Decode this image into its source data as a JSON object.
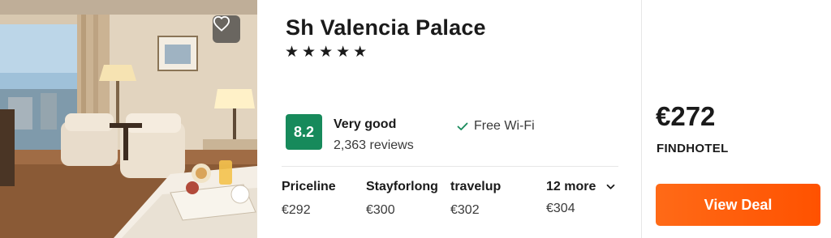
{
  "hotel": {
    "name": "Sh Valencia Palace",
    "stars": "★★★★★",
    "star_count": 5,
    "score": "8.2",
    "rating_word": "Very good",
    "review_count": "2,363 reviews"
  },
  "amenities": [
    "Free Wi-Fi"
  ],
  "providers": [
    {
      "name": "Priceline",
      "price": "€292"
    },
    {
      "name": "Stayforlong",
      "price": "€300"
    },
    {
      "name": "travelup",
      "price": "€302"
    }
  ],
  "more": {
    "label": "12 more",
    "price": "€304"
  },
  "best_deal": {
    "price": "€272",
    "provider": "FINDHOTEL",
    "button_label": "View Deal"
  },
  "icons": {
    "favorite": "heart-icon",
    "amenity_check": "check-icon",
    "expand": "chevron-down-icon"
  },
  "colors": {
    "score_badge": "#178a5b",
    "cta": "#ff5a0a",
    "check": "#178a5b"
  }
}
